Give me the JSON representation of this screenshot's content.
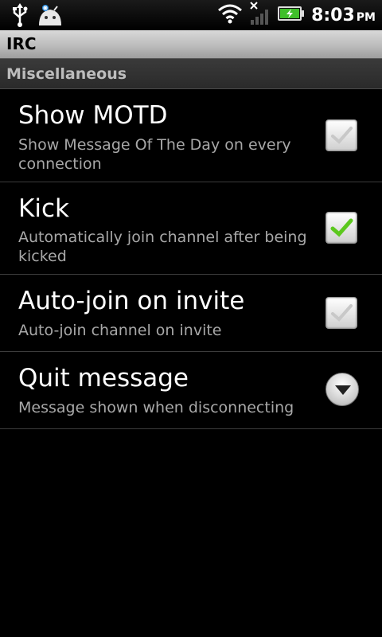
{
  "status_bar": {
    "time": "8:03",
    "ampm": "PM",
    "icons": [
      "usb-icon",
      "android-icon",
      "wifi-icon",
      "no-signal-icon",
      "battery-charging-icon"
    ]
  },
  "title_bar": {
    "title": "IRC"
  },
  "section": {
    "label": "Miscellaneous"
  },
  "preferences": [
    {
      "title": "Show MOTD",
      "summary": "Show Message Of The Day on every connection",
      "type": "checkbox",
      "checked": false
    },
    {
      "title": "Kick",
      "summary": "Automatically join channel after being kicked",
      "type": "checkbox",
      "checked": true
    },
    {
      "title": "Auto-join on invite",
      "summary": "Auto-join channel on invite",
      "type": "checkbox",
      "checked": false
    },
    {
      "title": "Quit message",
      "summary": "Message shown when disconnecting",
      "type": "dropdown"
    }
  ],
  "colors": {
    "check_on": "#5cc81e",
    "check_off": "#c8c8c8"
  }
}
